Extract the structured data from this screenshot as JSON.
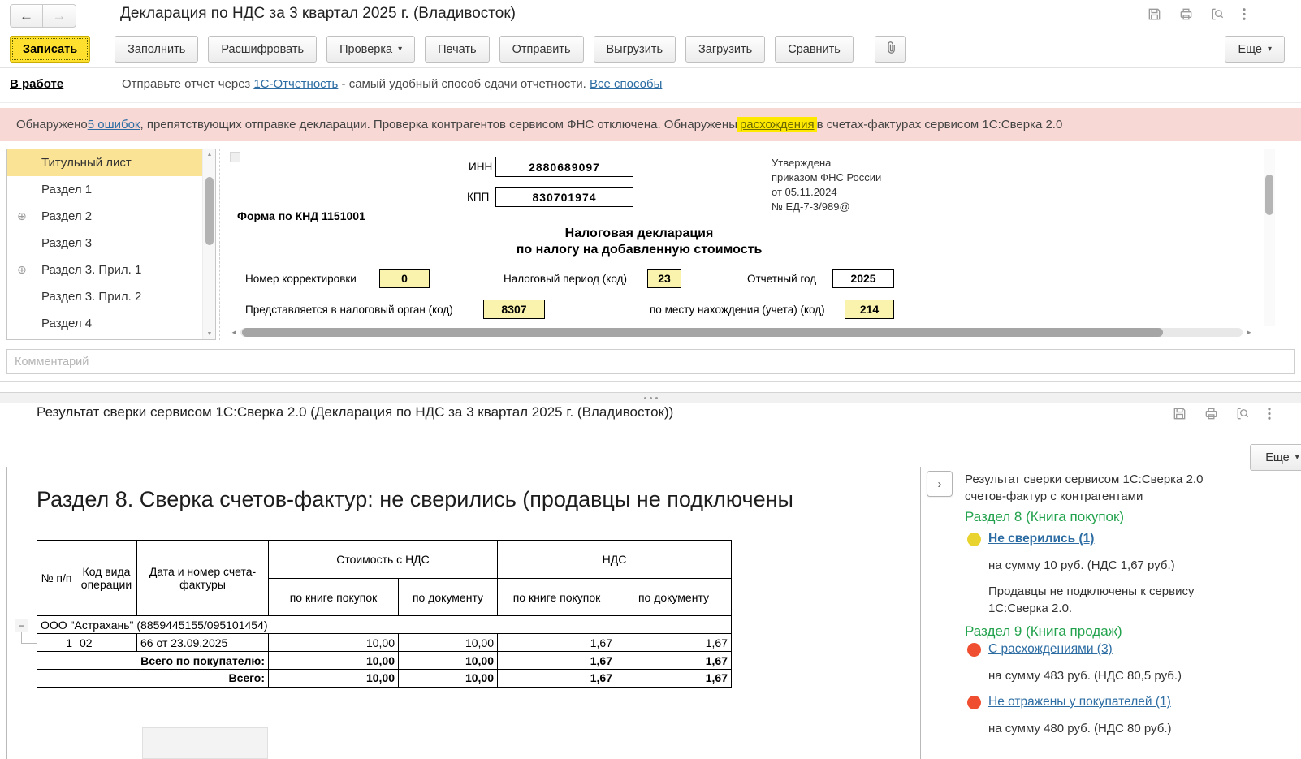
{
  "colors": {
    "accent_yellow": "#FFE02E",
    "field_yellow": "#FAF3AE",
    "selected_item": "#FBE395",
    "banner_pink": "#F8D8D4",
    "link_blue": "#2d6da3",
    "section_green": "#22A24C",
    "status_yellow_dot": "#E9D32E",
    "status_red_dot": "#EF4F30",
    "group_row_blue": "#20409A"
  },
  "icons": {
    "back": "←",
    "forward": "→",
    "dropdown": "▾",
    "expand": "⊕",
    "collapse": "−",
    "panel_toggle": "›",
    "scroll_up": "▲",
    "scroll_down": "▼",
    "scroll_left": "◄",
    "scroll_right": "►"
  },
  "window1": {
    "title": "Декларация по НДС за 3 квартал 2025 г. (Владивосток)",
    "toolbar": {
      "save": "Записать",
      "fill": "Заполнить",
      "decrypt": "Расшифровать",
      "check": "Проверка",
      "print": "Печать",
      "send": "Отправить",
      "export": "Выгрузить",
      "import": "Загрузить",
      "compare": "Сравнить",
      "more": "Еще"
    },
    "status": {
      "state": "В работе",
      "prefix": "Отправьте отчет через ",
      "link1": "1С-Отчетность",
      "middle": " - самый удобный способ сдачи отчетности. ",
      "link2": "Все способы"
    },
    "banner": {
      "part1": "Обнаружено ",
      "errors_link": "5 ошибок",
      "part2": ", препятствующих отправке декларации. Проверка контрагентов сервисом ФНС отключена. Обнаружены ",
      "discrepancy_link": "расхождения",
      "part3": " в счетах-фактурах сервисом 1С:Сверка 2.0"
    },
    "sidebar": {
      "items": [
        {
          "label": "Титульный лист"
        },
        {
          "label": "Раздел 1"
        },
        {
          "label": "Раздел 2"
        },
        {
          "label": "Раздел 3"
        },
        {
          "label": "Раздел 3. Прил. 1"
        },
        {
          "label": "Раздел 3. Прил. 2"
        },
        {
          "label": "Раздел 4"
        }
      ]
    },
    "form": {
      "inn_label": "ИНН",
      "inn": "2880689097",
      "kpp_label": "КПП",
      "kpp": "830701974",
      "knd": "Форма по КНД 1151001",
      "approved": [
        "Утверждена",
        "приказом ФНС России",
        "от 05.11.2024",
        "№ ЕД-7-3/989@"
      ],
      "title_line1": "Налоговая декларация",
      "title_line2": "по налогу на добавленную стоимость",
      "correction_label": "Номер корректировки",
      "correction": "0",
      "period_label": "Налоговый период (код)",
      "period": "23",
      "year_label": "Отчетный год",
      "year": "2025",
      "authority_label": "Представляется в налоговый орган (код)",
      "authority": "8307",
      "location_label": "по месту нахождения (учета) (код)",
      "location": "214"
    },
    "comment_placeholder": "Комментарий"
  },
  "window2": {
    "title": "Результат сверки сервисом 1С:Сверка 2.0 (Декларация по НДС за 3 квартал 2025 г. (Владивосток))",
    "more": "Еще",
    "section_heading": "Раздел 8. Сверка счетов-фактур: не сверились (продавцы не подключены",
    "table": {
      "col_num": "№ п/п",
      "col_opcode": "Код вида операции",
      "col_invoice": "Дата и номер счета-фактуры",
      "col_cost": "Стоимость с НДС",
      "col_vat": "НДС",
      "col_by_book1": "по книге покупок",
      "col_by_doc1": "по документу",
      "col_by_book2": "по книге покупок",
      "col_by_doc2": "по документу",
      "group_row": "ООО \"Астрахань\" (8859445155/095101454)",
      "rows": [
        {
          "num": "1",
          "code": "02",
          "invoice": "66 от 23.09.2025",
          "cost_book": "10,00",
          "cost_doc": "10,00",
          "vat_book": "1,67",
          "vat_doc": "1,67"
        }
      ],
      "total_buyer_label": "Всего по покупателю:",
      "total_buyer": [
        "10,00",
        "10,00",
        "1,67",
        "1,67"
      ],
      "total_label": "Всего:",
      "total": [
        "10,00",
        "10,00",
        "1,67",
        "1,67"
      ]
    },
    "panel": {
      "header_line1": "Результат сверки сервисом 1С:Сверка 2.0",
      "header_line2": "счетов-фактур с контрагентами",
      "section8_title": "Раздел 8 (Книга покупок)",
      "section8_link": "Не сверились (1)",
      "section8_sum": "на сумму 10 руб. (НДС 1,67 руб.)",
      "section8_note1": "Продавцы не подключены к сервису",
      "section8_note2": "1С:Сверка 2.0.",
      "section9_title": "Раздел 9 (Книга продаж)",
      "section9_link1": "С расхождениями (3)",
      "section9_sum1": "на сумму 483 руб. (НДС 80,5 руб.)",
      "section9_link2": "Не отражены у покупателей (1)",
      "section9_sum2": "на сумму 480 руб. (НДС 80 руб.)"
    }
  }
}
